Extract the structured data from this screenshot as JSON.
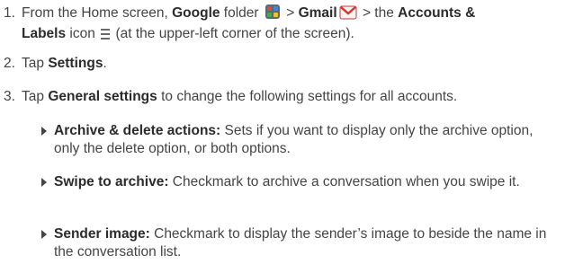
{
  "steps": [
    {
      "num": "1.",
      "a": "From the Home screen, ",
      "b": "Google",
      "c": " folder ",
      "d": " > ",
      "e": "Gmail",
      "f": " > the ",
      "g": "Accounts &",
      "h": "Labels",
      "i": " icon ",
      "j": " (at the upper-left corner of the screen)."
    },
    {
      "num": "2.",
      "a": "Tap ",
      "b": "Settings",
      "c": "."
    },
    {
      "num": "3.",
      "a": "Tap ",
      "b": "General settings",
      "c": " to change the following settings for all accounts."
    }
  ],
  "bullets": [
    {
      "title": "Archive & delete actions:",
      "text": " Sets if you want to display only the archive option, only the delete option, or both options."
    },
    {
      "title": "Swipe to archive:",
      "text": " Checkmark to archive a conversation when you swipe it."
    },
    {
      "title": "Sender image:",
      "text": " Checkmark to display the sender’s image to beside the name in the conversation list."
    }
  ],
  "icons": {
    "google_folder": "google-folder-icon",
    "gmail": "gmail-icon",
    "accounts_labels": "menu-lines-icon"
  }
}
